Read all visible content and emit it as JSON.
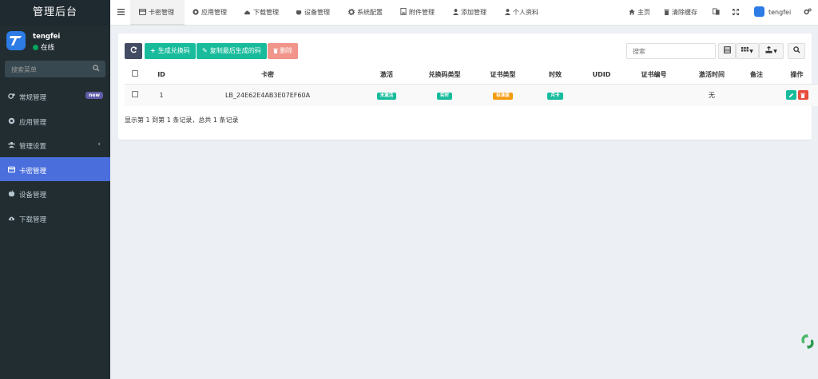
{
  "sidebar": {
    "title": "管理后台",
    "user": {
      "name": "tengfei",
      "status": "在线"
    },
    "search": {
      "placeholder": "搜索菜单"
    },
    "items": [
      {
        "label": "常规管理",
        "icon": "cogs-icon",
        "badge": "new"
      },
      {
        "label": "应用管理",
        "icon": "chrome-icon"
      },
      {
        "label": "管理设置",
        "icon": "users-icon"
      },
      {
        "label": "卡密管理",
        "icon": "credit-card-icon",
        "active": true
      },
      {
        "label": "设备管理",
        "icon": "apple-icon"
      },
      {
        "label": "下载管理",
        "icon": "cloud-download-icon"
      }
    ]
  },
  "topbar": {
    "menu_icon": "bars-icon",
    "tabs": [
      {
        "label": "卡密管理",
        "icon": "credit-card-icon",
        "active": true
      },
      {
        "label": "应用管理",
        "icon": "chrome-icon"
      },
      {
        "label": "下载管理",
        "icon": "cloud-download-icon"
      },
      {
        "label": "设备管理",
        "icon": "apple-icon"
      },
      {
        "label": "系统配置",
        "icon": "cog-icon"
      },
      {
        "label": "附件管理",
        "icon": "file-image-icon"
      },
      {
        "label": "添加管理",
        "icon": "user-icon"
      },
      {
        "label": "个人资料",
        "icon": "user-icon"
      }
    ],
    "right": {
      "home": "主页",
      "clear_cache": "清除缓存",
      "user": "tengfei"
    }
  },
  "toolbar": {
    "generate": "生成兑换码",
    "copy_last": "复制最后生成的码",
    "delete": "删除",
    "search_placeholder": "搜索"
  },
  "table": {
    "columns": [
      "ID",
      "卡密",
      "激活",
      "兑换码类型",
      "证书类型",
      "时效",
      "UDID",
      "证书编号",
      "激活时间",
      "备注",
      "操作"
    ],
    "rows": [
      {
        "id": "1",
        "card": "LB_24E62E4AB3E07EF60A",
        "activated": "未激活",
        "code_type": "实时",
        "cert_type": "标准版",
        "duration": "月卡",
        "udid": "",
        "cert_no": "",
        "activated_time": "无",
        "remark": ""
      }
    ]
  },
  "pagination": {
    "text": "显示第 1 到第 1 条记录，总共 1 条记录"
  },
  "colors": {
    "sidebar_bg": "#222d32",
    "active_menu": "#4a6fdc",
    "success": "#18bc9c",
    "warning": "#f39c12",
    "danger": "#e74c3c"
  }
}
